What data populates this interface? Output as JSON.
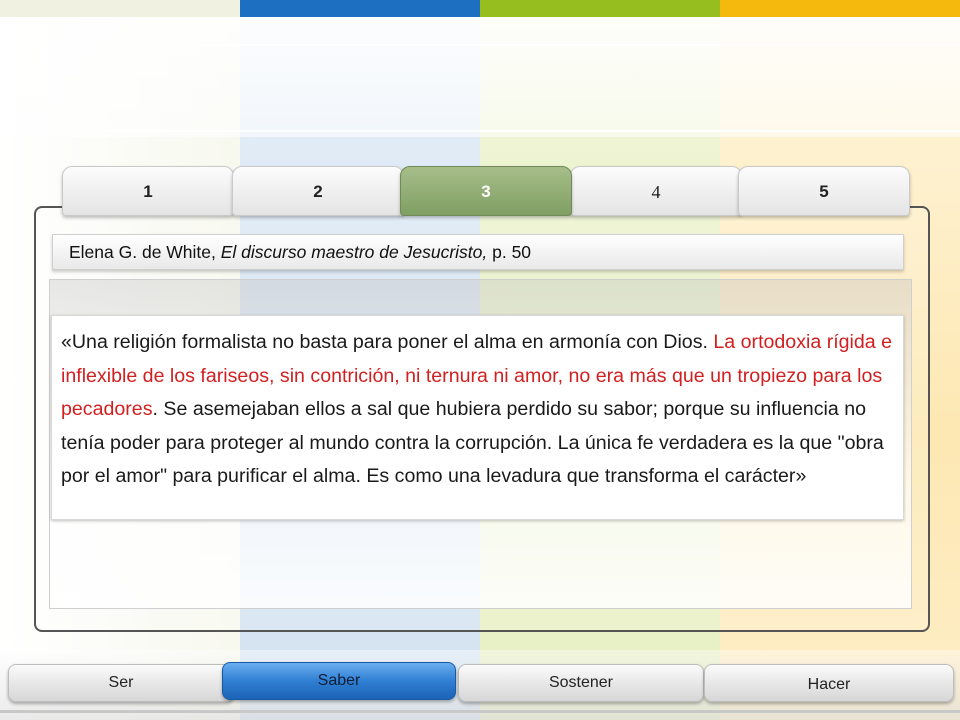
{
  "colors": {
    "stripe_blue": "#1c6fc1",
    "stripe_green": "#95be1e",
    "stripe_yellow": "#f5b90e",
    "active_tab": "#7f9f63",
    "active_nav": "#2f7fd3",
    "quote_red": "#d21f1f"
  },
  "tabs": [
    {
      "label": "1",
      "active": false
    },
    {
      "label": "2",
      "active": false
    },
    {
      "label": "3",
      "active": true
    },
    {
      "label": "4",
      "active": false
    },
    {
      "label": "5",
      "active": false
    }
  ],
  "citation": {
    "author": "Elena G. de White, ",
    "book": "El discurso maestro de Jesucristo,",
    "page": " p. 50"
  },
  "quote": {
    "part1": "«Una religión formalista no basta para poner el alma en armonía con Dios. ",
    "red": "La ortodoxia rígida e inflexible de los fariseos, sin contrición, ni ternura ni amor, no era más que un tropiezo para los pecadores",
    "part2": ". Se asemejaban ellos a sal que hubiera perdido su sabor; porque su influencia no tenía poder para proteger al mundo contra la corrupción. La única fe verdadera es la que \"obra por el amor\" para purificar el alma. Es como una levadura que transforma el carácter»"
  },
  "bottom_nav": [
    {
      "label": "Ser",
      "active": false
    },
    {
      "label": "Saber",
      "active": true
    },
    {
      "label": "Sostener",
      "active": false
    },
    {
      "label": "Hacer",
      "active": false
    }
  ]
}
